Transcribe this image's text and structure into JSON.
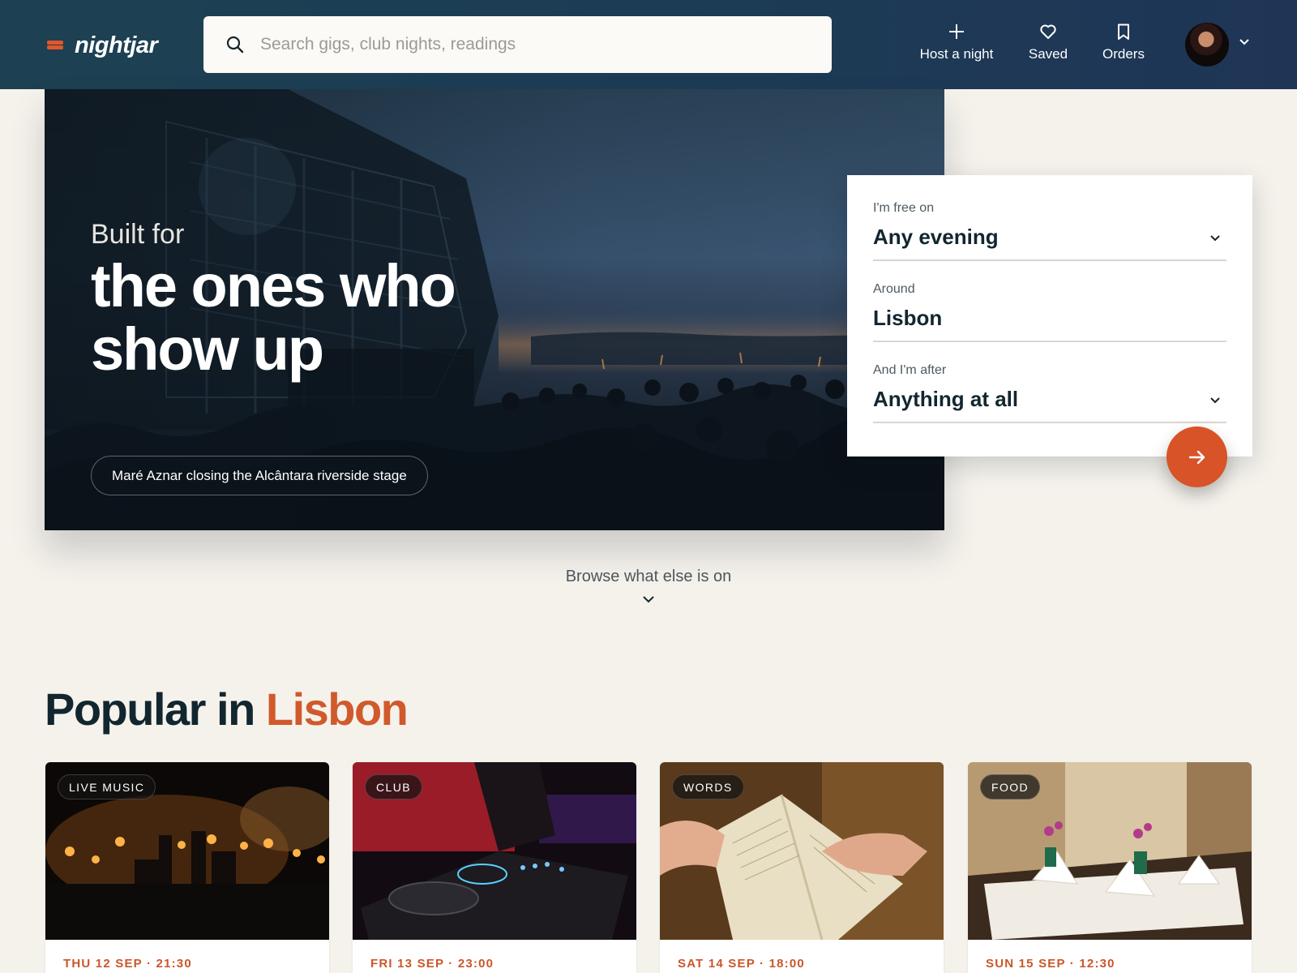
{
  "brand": {
    "name": "nightjar"
  },
  "search": {
    "placeholder": "Search gigs, club nights, readings",
    "value": ""
  },
  "nav": {
    "host_label": "Host a night",
    "saved_label": "Saved",
    "orders_label": "Orders"
  },
  "hero": {
    "eyebrow": "Built for",
    "title": "the ones who show up",
    "caption": "Maré Aznar closing the Alcântara riverside stage"
  },
  "finder": {
    "date": {
      "label": "I'm free on",
      "value": "Any evening"
    },
    "location": {
      "label": "Around",
      "value": "Lisbon"
    },
    "category": {
      "label": "And I'm after",
      "value": "Anything at all"
    }
  },
  "browse": {
    "label": "Browse what else is on"
  },
  "section": {
    "title_prefix": "Popular in",
    "city": "Lisbon"
  },
  "cards": [
    {
      "tag": "LIVE MUSIC",
      "date": "THU 12 SEP · 21:30"
    },
    {
      "tag": "CLUB",
      "date": "FRI 13 SEP · 23:00"
    },
    {
      "tag": "WORDS",
      "date": "SAT 14 SEP · 18:00"
    },
    {
      "tag": "FOOD",
      "date": "SUN 15 SEP · 12:30"
    }
  ],
  "colors": {
    "accent": "#d85328",
    "header": "#1d3e54",
    "background": "#f5f2ec",
    "ink": "#12262f"
  }
}
